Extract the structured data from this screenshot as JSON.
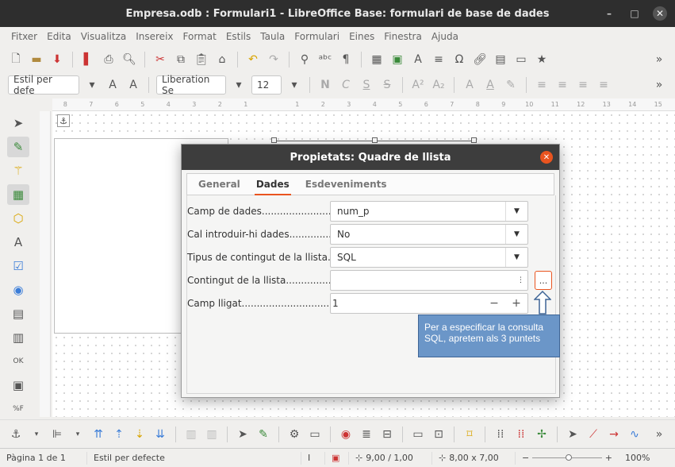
{
  "window": {
    "title": "Empresa.odb : Formulari1 - LibreOffice Base: formulari de base de dades",
    "minimize_icon": "minimize-icon",
    "maximize_icon": "maximize-icon",
    "close_icon": "close-icon"
  },
  "menubar": {
    "items": [
      "Fitxer",
      "Edita",
      "Visualitza",
      "Insereix",
      "Format",
      "Estils",
      "Taula",
      "Formulari",
      "Eines",
      "Finestra",
      "Ajuda"
    ]
  },
  "format_toolbar": {
    "paragraph_style": "Estil per defe",
    "font_name": "Liberation Se",
    "font_size": "12"
  },
  "dialog": {
    "title": "Propietats: Quadre de llista",
    "tabs": [
      "General",
      "Dades",
      "Esdeveniments"
    ],
    "active_tab": "Dades",
    "properties": [
      {
        "label": "Camp de dades............................",
        "value": "num_p"
      },
      {
        "label": "Cal introduir-hi dades.................",
        "value": "No"
      },
      {
        "label": "Tipus de contingut de la llista....",
        "value": "SQL"
      },
      {
        "label": "Contingut de la llista..................",
        "value": ""
      },
      {
        "label": "Camp lligat................................",
        "value": "1"
      }
    ],
    "ellipsis_label": "...",
    "spin_minus": "−",
    "spin_plus": "+"
  },
  "callout": {
    "text": "Per a especificar la consulta SQL, apretem als 3 puntets"
  },
  "statusbar": {
    "page": "Pàgina 1 de 1",
    "style": "Estil per defecte",
    "position": "9,00 / 1,00",
    "size": "8,00 x 7,00",
    "zoom": "100%"
  },
  "ruler": {
    "ticks": [
      "8",
      "7",
      "6",
      "5",
      "4",
      "3",
      "2",
      "1",
      "",
      "1",
      "2",
      "3",
      "4",
      "5",
      "6",
      "7",
      "8",
      "9",
      "10",
      "11",
      "12",
      "13",
      "14",
      "15"
    ]
  },
  "colors": {
    "accent": "#e9541f",
    "titlebar": "#2e2e2e",
    "callout": "#6b96c8"
  }
}
